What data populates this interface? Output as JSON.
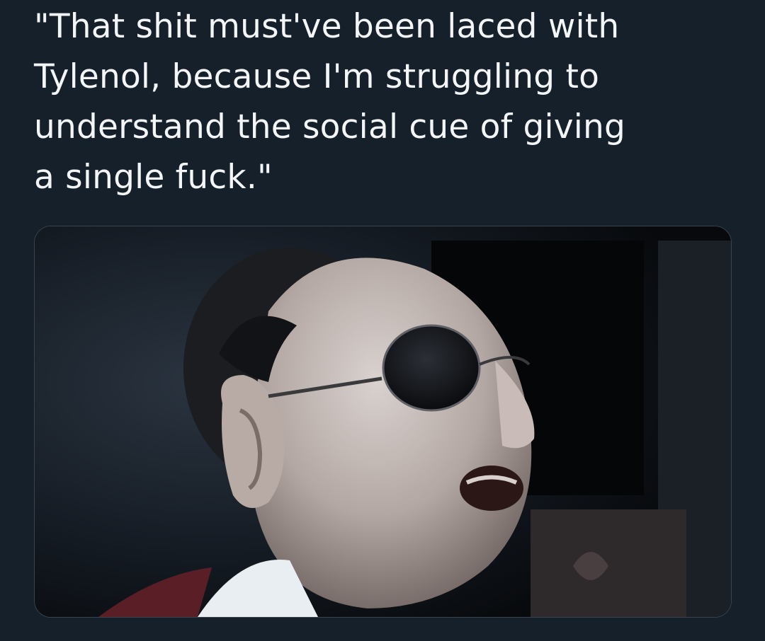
{
  "tweet": {
    "text": "\"That shit must've been laced with\nTylenol, because I'm struggling to\nunderstand the social cue of giving\na single fuck.\""
  },
  "media": {
    "type": "photo",
    "icon": "photo-icon"
  },
  "colors": {
    "background": "#15202b",
    "text": "#f3f5f7",
    "media_border": "#38444d"
  }
}
